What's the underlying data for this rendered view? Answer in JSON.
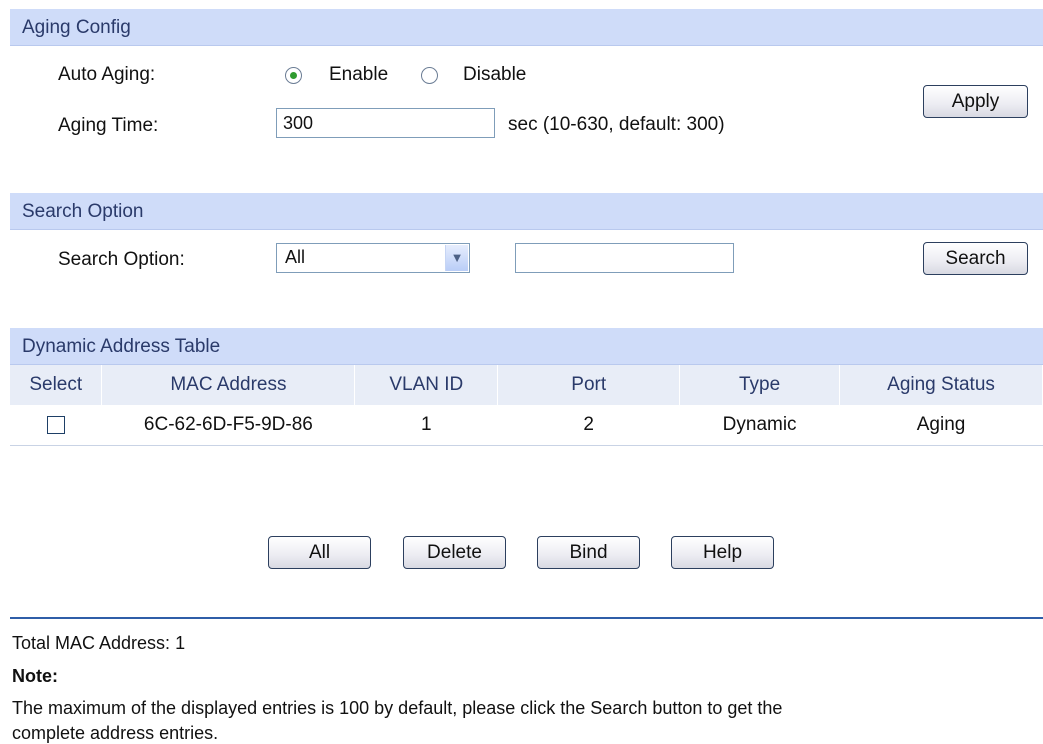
{
  "aging_config": {
    "header": "Aging Config",
    "auto_aging_label": "Auto Aging:",
    "enable_label": "Enable",
    "disable_label": "Disable",
    "aging_time_label": "Aging Time:",
    "aging_time_value": "300",
    "aging_time_hint": "sec (10-630, default: 300)",
    "apply_button": "Apply"
  },
  "search_option": {
    "header": "Search Option",
    "label": "Search Option:",
    "selected": "All",
    "search_button": "Search"
  },
  "dynamic_table": {
    "header": "Dynamic Address Table",
    "columns": [
      "Select",
      "MAC Address",
      "VLAN ID",
      "Port",
      "Type",
      "Aging Status"
    ],
    "rows": [
      {
        "mac": "6C-62-6D-F5-9D-86",
        "vlan": "1",
        "port": "2",
        "type": "Dynamic",
        "status": "Aging"
      }
    ]
  },
  "actions": {
    "all": "All",
    "delete": "Delete",
    "bind": "Bind",
    "help": "Help"
  },
  "footer": {
    "total": "Total MAC Address: 1",
    "note_title": "Note:",
    "note_line1": "The maximum of the displayed entries is 100 by default, please click the Search button to get the",
    "note_line2": "complete address entries."
  }
}
